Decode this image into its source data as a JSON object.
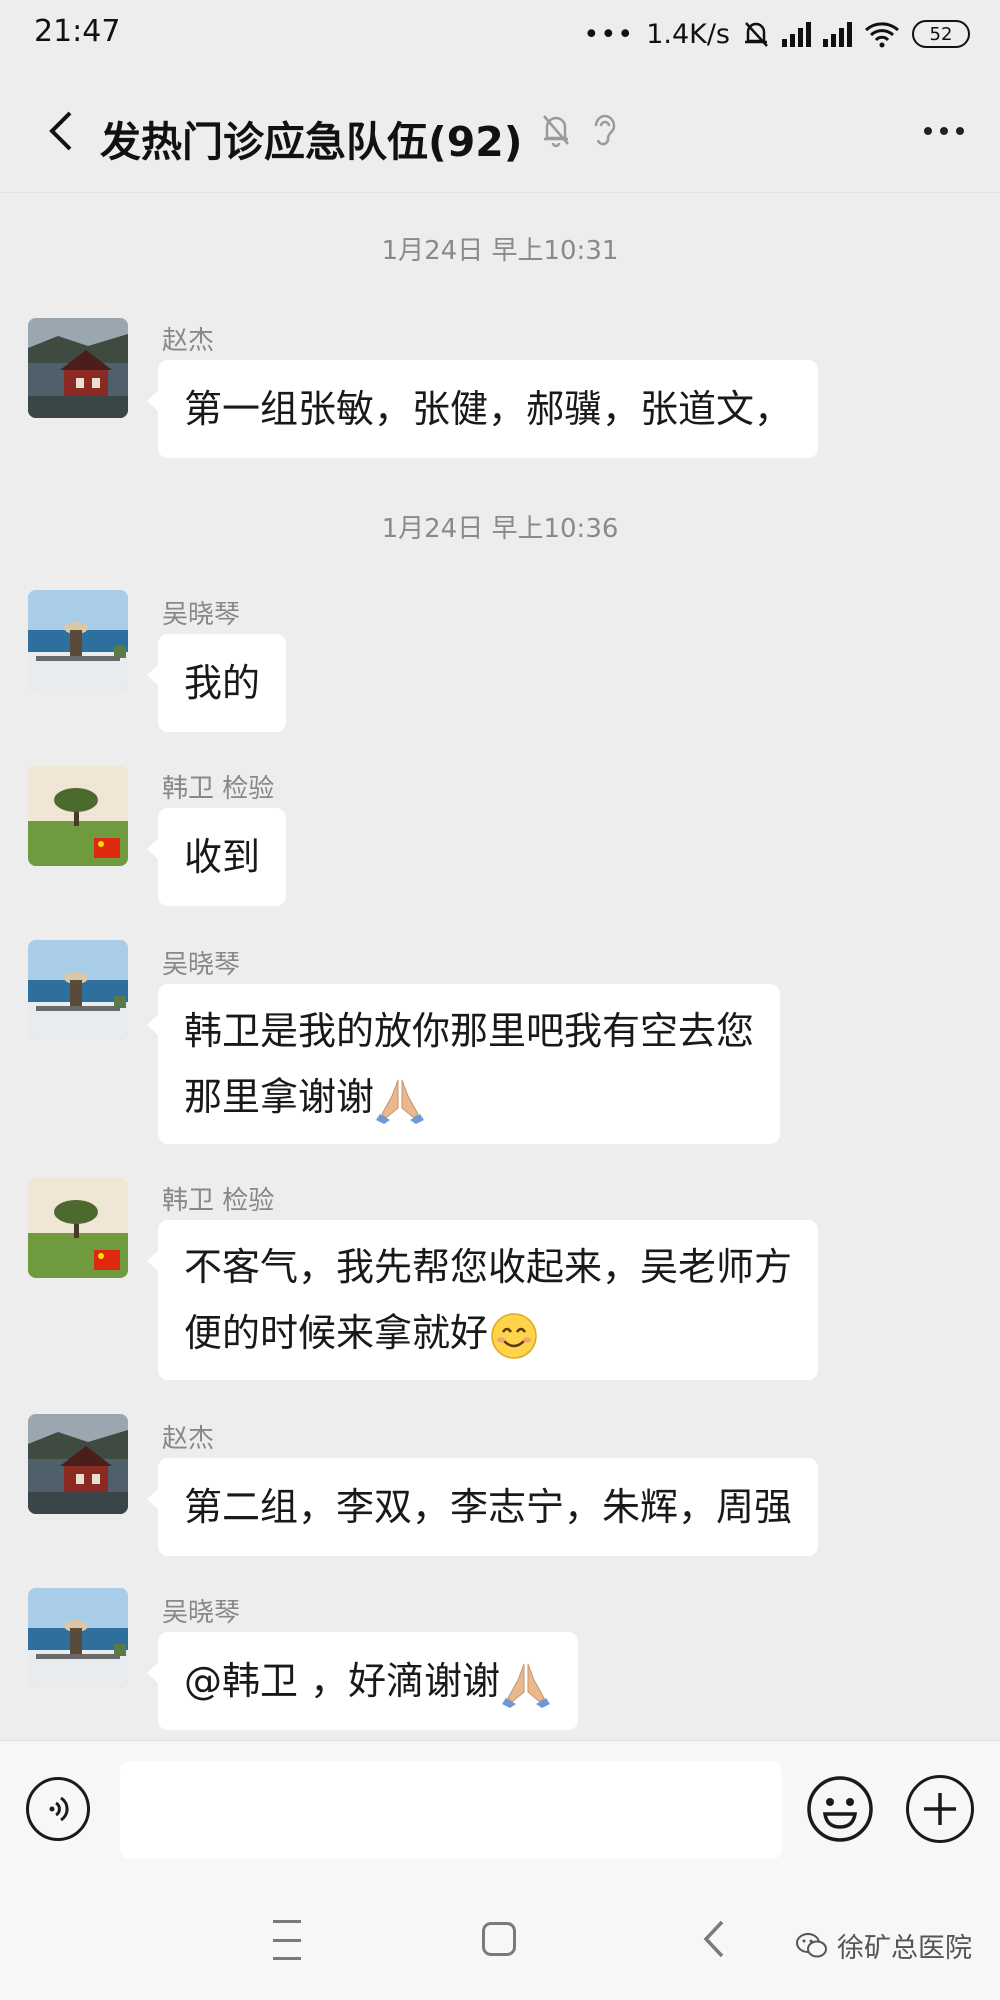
{
  "status_bar": {
    "time": "21:47",
    "network_speed": "1.4K/s",
    "battery": "52"
  },
  "header": {
    "title": "发热门诊应急队伍(92)"
  },
  "messages": [
    {
      "type": "timestamp",
      "text": "1月24日 早上10:31"
    },
    {
      "type": "message",
      "sender": "赵杰",
      "avatar": "house-photo",
      "text": "第一组张敏，张健，郝骥，张道文，"
    },
    {
      "type": "timestamp",
      "text": "1月24日 早上10:36"
    },
    {
      "type": "message",
      "sender": "吴晓琴",
      "avatar": "seaside-photo",
      "text": "我的"
    },
    {
      "type": "message",
      "sender": "韩卫 检验",
      "avatar": "tree-photo",
      "text": "收到"
    },
    {
      "type": "message",
      "sender": "吴晓琴",
      "avatar": "seaside-photo",
      "lines": [
        "韩卫是我的放你那里吧我有空去您",
        "那里拿谢谢"
      ],
      "emoji": "folded-hands"
    },
    {
      "type": "message",
      "sender": "韩卫 检验",
      "avatar": "tree-photo",
      "lines": [
        "不客气，我先帮您收起来，吴老师方",
        "便的时候来拿就好"
      ],
      "emoji": "smiling-face"
    },
    {
      "type": "message",
      "sender": "赵杰",
      "avatar": "house-photo",
      "text": "第二组，李双，李志宁，朱辉，周强"
    },
    {
      "type": "message",
      "sender": "吴晓琴",
      "avatar": "seaside-photo",
      "text": "@韩卫 ，好滴谢谢",
      "emoji": "folded-hands"
    }
  ],
  "watermark": "徐矿总医院",
  "colors": {
    "background": "#ededed",
    "bubble": "#ffffff",
    "meta_text": "#888888"
  }
}
